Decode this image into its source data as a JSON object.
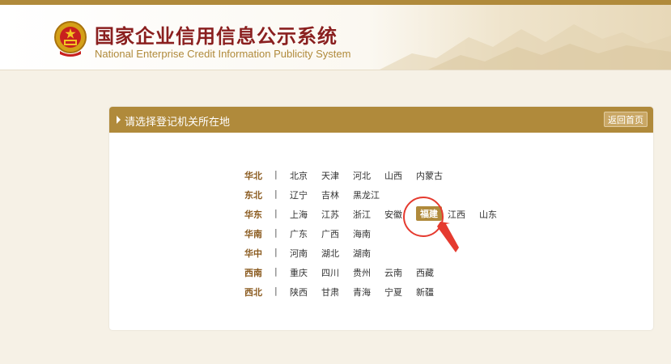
{
  "header": {
    "title": "国家企业信用信息公示系统",
    "subtitle": "National Enterprise Credit Information Publicity System"
  },
  "panel": {
    "title": "请选择登记机关所在地",
    "home_button": "返回首页"
  },
  "separator": "|",
  "colors": {
    "brand": "#b08a3b",
    "title_red": "#8a1f1f",
    "region_brown": "#8a5a1e",
    "annotation_red": "#e53a2f"
  },
  "regions": [
    {
      "name": "华北",
      "provinces": [
        "北京",
        "天津",
        "河北",
        "山西",
        "内蒙古"
      ]
    },
    {
      "name": "东北",
      "provinces": [
        "辽宁",
        "吉林",
        "黑龙江"
      ]
    },
    {
      "name": "华东",
      "provinces": [
        "上海",
        "江苏",
        "浙江",
        "安徽",
        "福建",
        "江西",
        "山东"
      ]
    },
    {
      "name": "华南",
      "provinces": [
        "广东",
        "广西",
        "海南"
      ]
    },
    {
      "name": "华中",
      "provinces": [
        "河南",
        "湖北",
        "湖南"
      ]
    },
    {
      "name": "西南",
      "provinces": [
        "重庆",
        "四川",
        "贵州",
        "云南",
        "西藏"
      ]
    },
    {
      "name": "西北",
      "provinces": [
        "陕西",
        "甘肃",
        "青海",
        "宁夏",
        "新疆"
      ]
    }
  ],
  "selected_province": "福建",
  "icons": {
    "emblem": "national-emblem-icon",
    "panel_marker": "triangle-right-icon",
    "annotation": "red-circle-arrow"
  }
}
